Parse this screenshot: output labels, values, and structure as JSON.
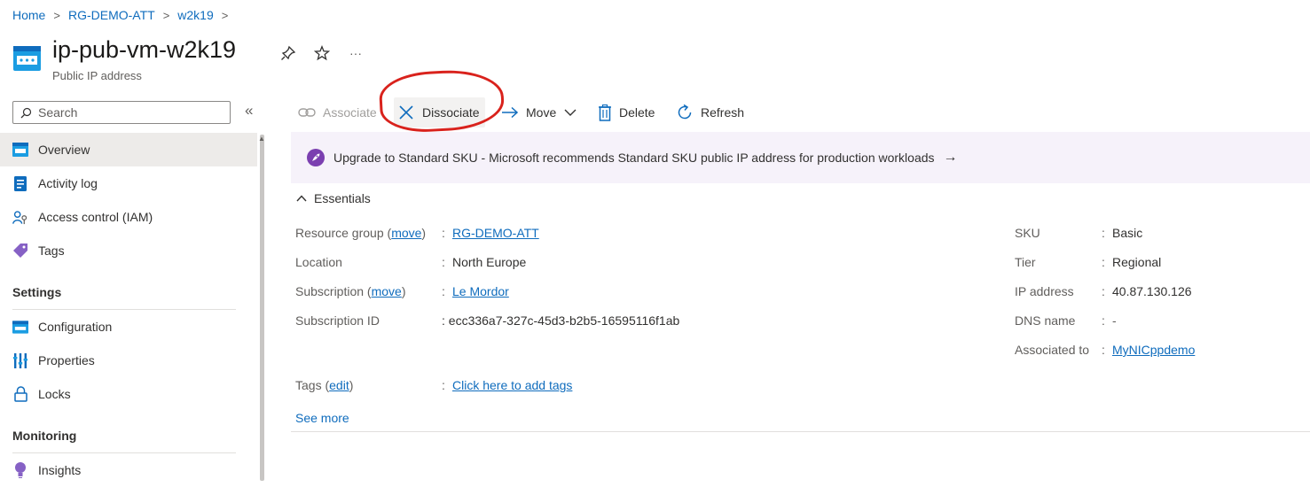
{
  "breadcrumb": [
    "Home",
    "RG-DEMO-ATT",
    "w2k19"
  ],
  "header": {
    "title": "ip-pub-vm-w2k19",
    "subtitle": "Public IP address",
    "more": "···"
  },
  "sidebar": {
    "search_placeholder": "Search",
    "collapse_glyph": "«",
    "items_top": [
      {
        "label": "Overview",
        "icon": "overview-icon",
        "selected": true
      },
      {
        "label": "Activity log",
        "icon": "activity-log-icon"
      },
      {
        "label": "Access control (IAM)",
        "icon": "iam-icon"
      },
      {
        "label": "Tags",
        "icon": "tag-icon"
      }
    ],
    "section_settings": "Settings",
    "items_settings": [
      {
        "label": "Configuration",
        "icon": "configuration-icon"
      },
      {
        "label": "Properties",
        "icon": "properties-icon"
      },
      {
        "label": "Locks",
        "icon": "lock-icon"
      }
    ],
    "section_monitoring": "Monitoring",
    "items_monitoring": [
      {
        "label": "Insights",
        "icon": "insights-icon"
      }
    ]
  },
  "toolbar": {
    "associate": "Associate",
    "dissociate": "Dissociate",
    "move": "Move",
    "delete": "Delete",
    "refresh": "Refresh"
  },
  "banner": {
    "text": "Upgrade to Standard SKU - Microsoft recommends Standard SKU public IP address for production workloads",
    "arrow": "→"
  },
  "essentials": {
    "title": "Essentials",
    "move_link": "move",
    "edit_link": "edit",
    "left": {
      "resource_group_label": "Resource group",
      "resource_group_value": "RG-DEMO-ATT",
      "location_label": "Location",
      "location_value": "North Europe",
      "subscription_label": "Subscription",
      "subscription_value": "Le Mordor",
      "subscription_id_label": "Subscription ID",
      "subscription_id_value": "ecc336a7-327c-45d3-b2b5-16595116f1ab",
      "tags_label": "Tags",
      "tags_value": "Click here to add tags"
    },
    "right": {
      "sku_label": "SKU",
      "sku_value": "Basic",
      "tier_label": "Tier",
      "tier_value": "Regional",
      "ip_label": "IP address",
      "ip_value": "40.87.130.126",
      "dns_label": "DNS name",
      "dns_value": "-",
      "associated_label": "Associated to",
      "associated_value": "MyNICppdemo"
    },
    "see_more": "See more"
  },
  "colors": {
    "link": "#0f6cbd",
    "annotation_ring": "#d9221c",
    "banner_bg": "#f6f2fa",
    "banner_icon": "#7b3fb0"
  }
}
